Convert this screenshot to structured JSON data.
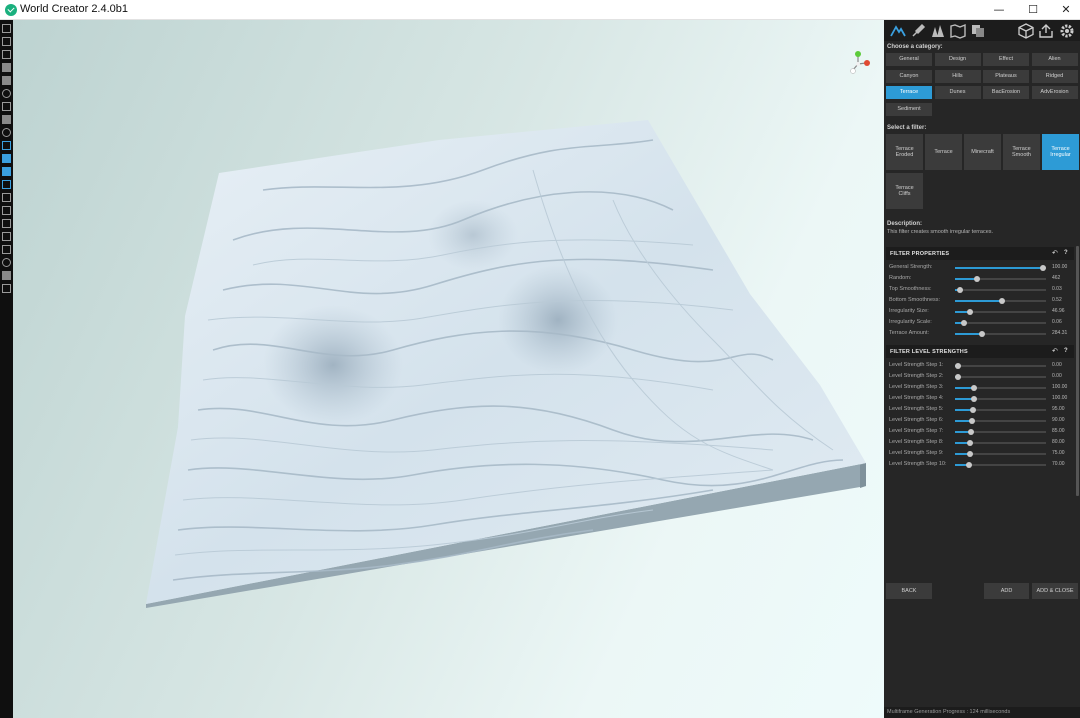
{
  "window": {
    "title": "World Creator 2.4.0b1",
    "minimize": "—",
    "maximize": "☐",
    "close": "✕"
  },
  "panel": {
    "category_label": "Choose a category:",
    "categories": [
      {
        "label": "General",
        "active": false
      },
      {
        "label": "Design",
        "active": false
      },
      {
        "label": "Effect",
        "active": false
      },
      {
        "label": "Alien",
        "active": false
      },
      {
        "label": "Canyon",
        "active": false
      },
      {
        "label": "Hills",
        "active": false
      },
      {
        "label": "Plateaus",
        "active": false
      },
      {
        "label": "Ridged",
        "active": false
      },
      {
        "label": "Terrace",
        "active": true
      },
      {
        "label": "Dunes",
        "active": false
      },
      {
        "label": "BacErosion",
        "active": false
      },
      {
        "label": "AdvErosion",
        "active": false
      },
      {
        "label": "Sediment",
        "active": false
      }
    ],
    "filter_label": "Select a filter:",
    "filters": [
      {
        "line1": "Terrace",
        "line2": "Eroded",
        "active": false
      },
      {
        "line1": "Terrace",
        "line2": "",
        "active": false
      },
      {
        "line1": "Minecraft",
        "line2": "",
        "active": false
      },
      {
        "line1": "Terrace",
        "line2": "Smooth",
        "active": false
      },
      {
        "line1": "Terrace",
        "line2": "Irregular",
        "active": true
      },
      {
        "line1": "Terrace",
        "line2": "Cliffs",
        "active": false
      }
    ],
    "description_label": "Description:",
    "description": "This filter creates smooth irregular terraces.",
    "filter_properties": {
      "header": "FILTER PROPERTIES",
      "rows": [
        {
          "label": "General Strength:",
          "value": "100.00",
          "fraction": 0.97
        },
        {
          "label": "Random:",
          "value": "462",
          "fraction": 0.24
        },
        {
          "label": "Top Smoothness:",
          "value": "0.03",
          "fraction": 0.05
        },
        {
          "label": "Bottom Smoothness:",
          "value": "0.52",
          "fraction": 0.52
        },
        {
          "label": "Irregularity Size:",
          "value": "46.96",
          "fraction": 0.17
        },
        {
          "label": "Irregularity Scale:",
          "value": "0.06",
          "fraction": 0.1
        },
        {
          "label": "Terrace Amount:",
          "value": "284.31",
          "fraction": 0.3
        }
      ]
    },
    "level_strengths": {
      "header": "FILTER LEVEL STRENGTHS",
      "rows": [
        {
          "label": "Level Strength Step 1:",
          "value": "0.00",
          "fraction": 0.03
        },
        {
          "label": "Level Strength Step 2:",
          "value": "0.00",
          "fraction": 0.03
        },
        {
          "label": "Level Strength Step 3:",
          "value": "100.00",
          "fraction": 0.21
        },
        {
          "label": "Level Strength Step 4:",
          "value": "100.00",
          "fraction": 0.21
        },
        {
          "label": "Level Strength Step 5:",
          "value": "95.00",
          "fraction": 0.2
        },
        {
          "label": "Level Strength Step 6:",
          "value": "90.00",
          "fraction": 0.19
        },
        {
          "label": "Level Strength Step 7:",
          "value": "85.00",
          "fraction": 0.18
        },
        {
          "label": "Level Strength Step 8:",
          "value": "80.00",
          "fraction": 0.17
        },
        {
          "label": "Level Strength Step 9:",
          "value": "75.00",
          "fraction": 0.16
        },
        {
          "label": "Level Strength Step 10:",
          "value": "70.00",
          "fraction": 0.15
        }
      ]
    },
    "buttons": {
      "back": "BACK",
      "add": "ADD",
      "add_close": "ADD & CLOSE"
    },
    "status": "Multiframe Generation Progress : 124 milliseconds"
  },
  "colors": {
    "accent": "#2d9bd6",
    "panel_bg": "#262626",
    "terrain_top": "#dbe7f0",
    "terrain_side": "#8fa1ab"
  }
}
